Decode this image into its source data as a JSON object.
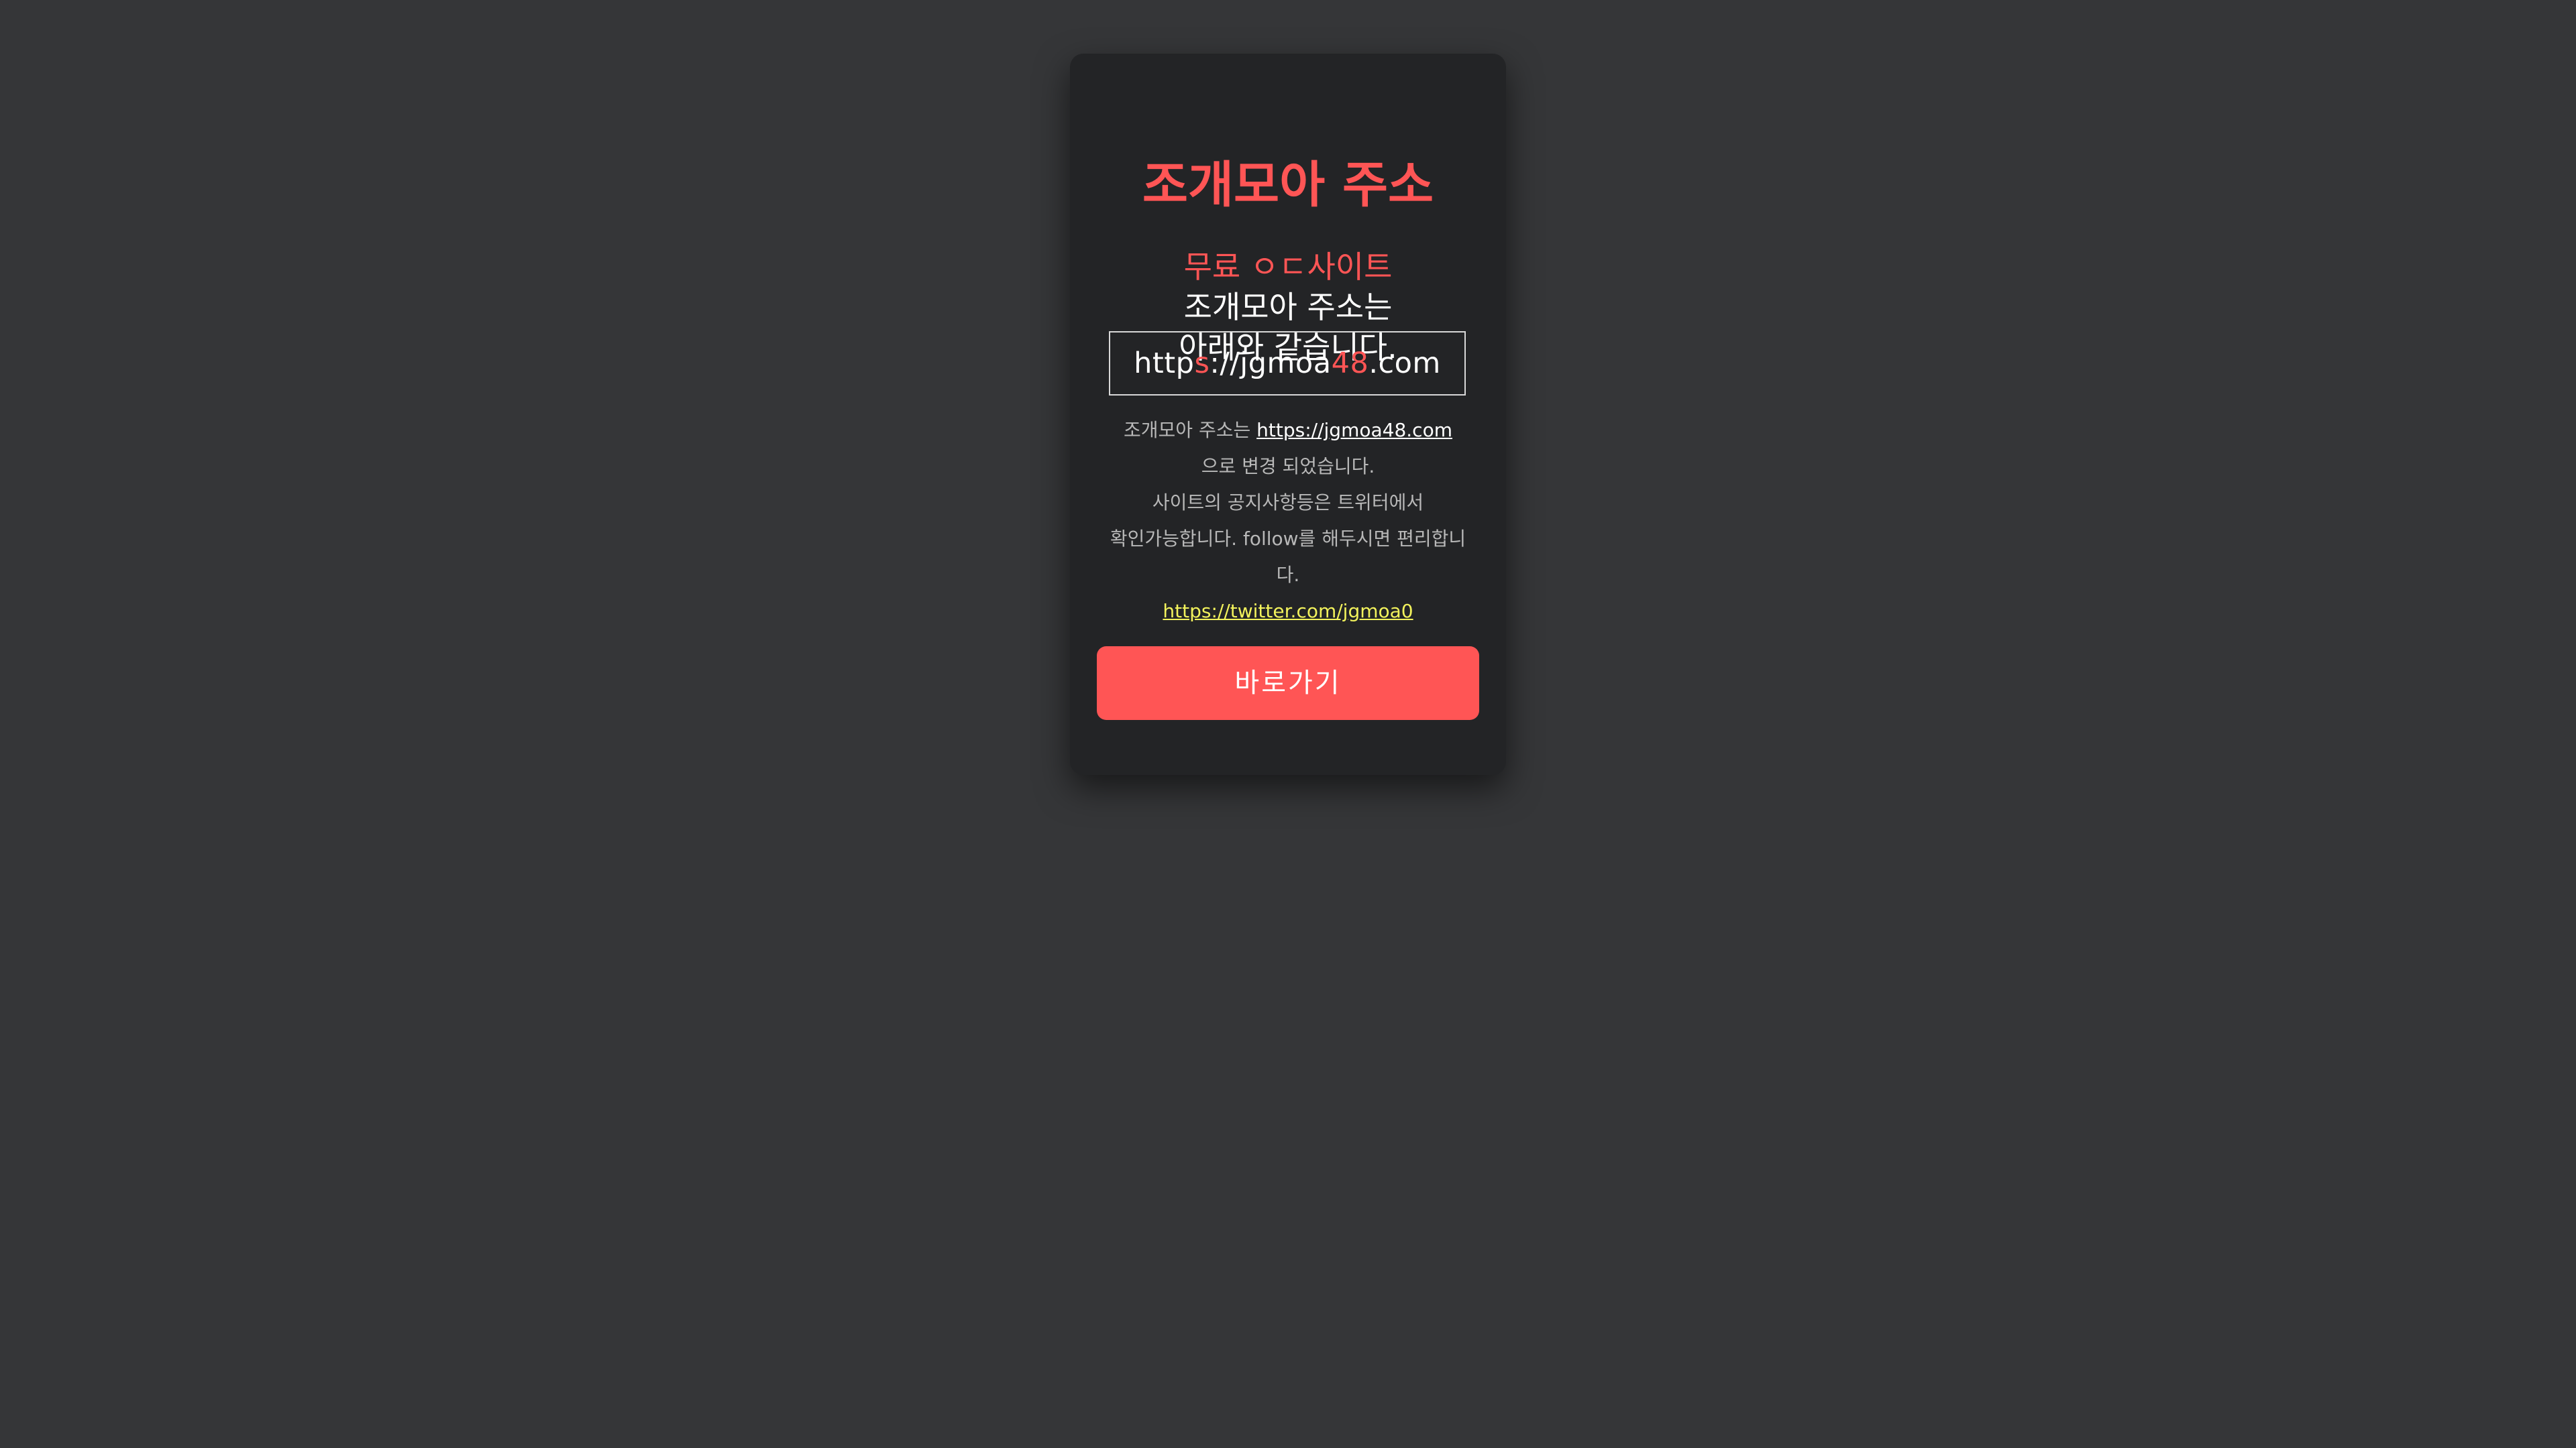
{
  "title": "조개모아 주소",
  "subtitle": {
    "line1": "무료 ㅇㄷ사이트",
    "line2": "조개모아 주소는",
    "line3": "아래와 같습니다."
  },
  "address": {
    "part1": "http",
    "part2": "s",
    "part3": "://jgmoa",
    "part4": "48",
    "part5": ".com"
  },
  "info": {
    "prefix": "조개모아 주소는 ",
    "link": "https://jgmoa48.com",
    "line2": "으로 변경 되었습니다.",
    "line3": "사이트의 공지사항등은 트위터에서",
    "line4": "확인가능합니다. follow를 해두시면 편리합니",
    "line5": "다.",
    "twitter_link": "https://twitter.com/jgmoa0"
  },
  "button_label": "바로가기",
  "colors": {
    "background": "#353638",
    "card": "#232426",
    "accent": "#ff5555",
    "twitter_link": "#f2f25c"
  }
}
